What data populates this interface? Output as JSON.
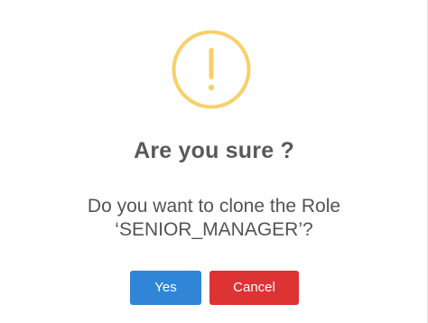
{
  "dialog": {
    "icon": "warning-exclamation-icon",
    "icon_glyph": "!",
    "title": "Are you sure ?",
    "message_line1": "Do you want to clone the Role",
    "message_line2": "‘SENIOR_MANAGER’?",
    "confirm_label": "Yes",
    "cancel_label": "Cancel"
  },
  "colors": {
    "warning": "#f8d06b",
    "confirm": "#3085d6",
    "cancel": "#dd3333",
    "title_text": "#595959",
    "body_text": "#545454"
  }
}
